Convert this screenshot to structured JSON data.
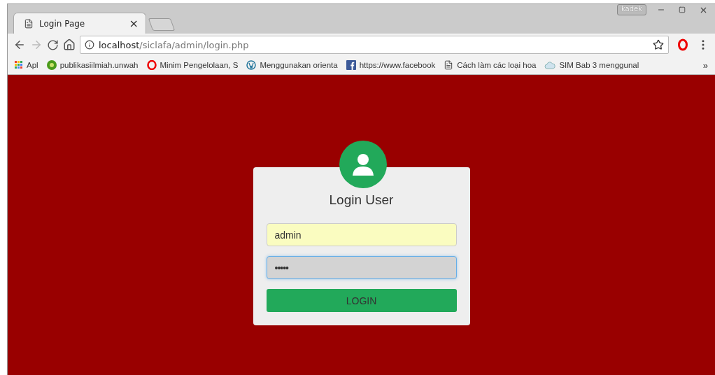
{
  "tabs": [
    {
      "title": "Login Page",
      "close": "×",
      "selected": true
    }
  ],
  "window_controls": {
    "user": "kadek"
  },
  "address_bar": {
    "host": "localhost",
    "path": "/siclafa/admin/login.php"
  },
  "bookmarks": [
    {
      "kind": "apps",
      "label": "Apl"
    },
    {
      "kind": "site",
      "label": "publikasiilmiah.unwah"
    },
    {
      "kind": "opera",
      "label": "Minim Pengelolaan, S"
    },
    {
      "kind": "wordpress",
      "label": "Menggunakan orienta"
    },
    {
      "kind": "facebook",
      "label": "https://www.facebook"
    },
    {
      "kind": "page",
      "label": "Cách làm các loại hoa"
    },
    {
      "kind": "cloud",
      "label": "SIM Bab 3 menggunal"
    }
  ],
  "bookmarks_more": "»",
  "login": {
    "title": "Login User",
    "fields": [
      {
        "kind": "text",
        "value": "admin",
        "autofilled": true,
        "focused": false
      },
      {
        "kind": "password",
        "value": "•••••",
        "autofilled": false,
        "focused": true
      }
    ],
    "button": "LOGIN"
  }
}
